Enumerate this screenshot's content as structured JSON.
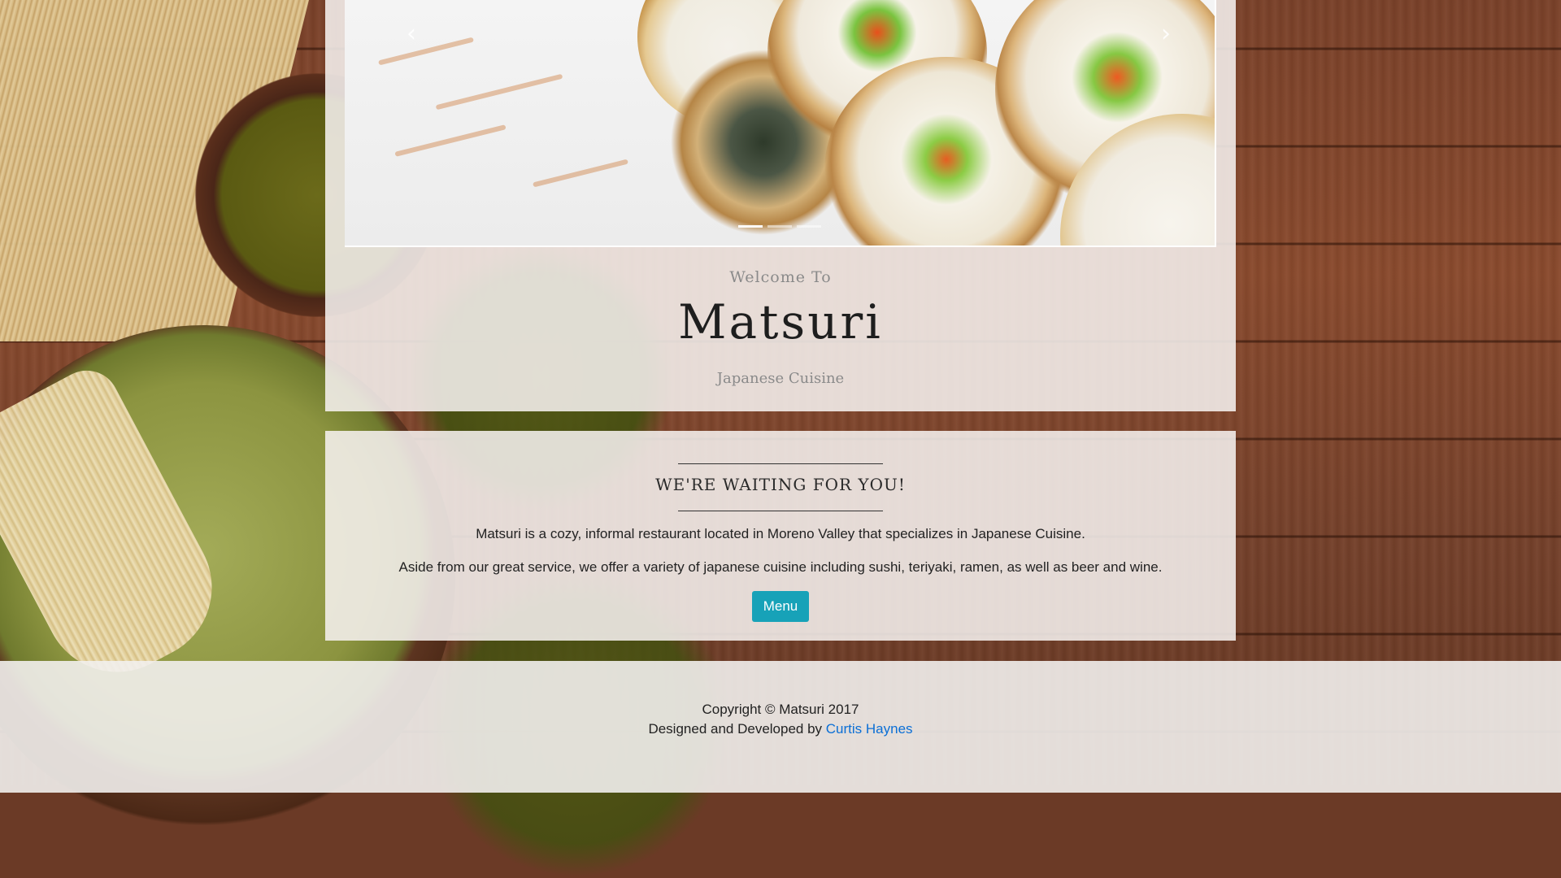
{
  "hero": {
    "carousel": {
      "prev_icon": "chevron-left-icon",
      "next_icon": "chevron-right-icon",
      "indicator_count": 3,
      "active_indicator": 0
    },
    "welcome": "Welcome To",
    "brand": "Matsuri",
    "tagline": "Japanese Cuisine"
  },
  "about": {
    "heading": "WE'RE WAITING FOR YOU!",
    "paragraph1": "Matsuri is a cozy, informal restaurant located in Moreno Valley that specializes in Japanese Cuisine.",
    "paragraph2": "Aside from our great service, we offer a variety of japanese cuisine including sushi, teriyaki, ramen, as well as beer and wine.",
    "menu_button": "Menu",
    "button_color": "#17a2b8"
  },
  "footer": {
    "copyright": "Copyright © Matsuri 2017",
    "designed_by": "Designed and Developed by",
    "author": "Curtis Haynes",
    "link_color": "#0b6fd6"
  }
}
